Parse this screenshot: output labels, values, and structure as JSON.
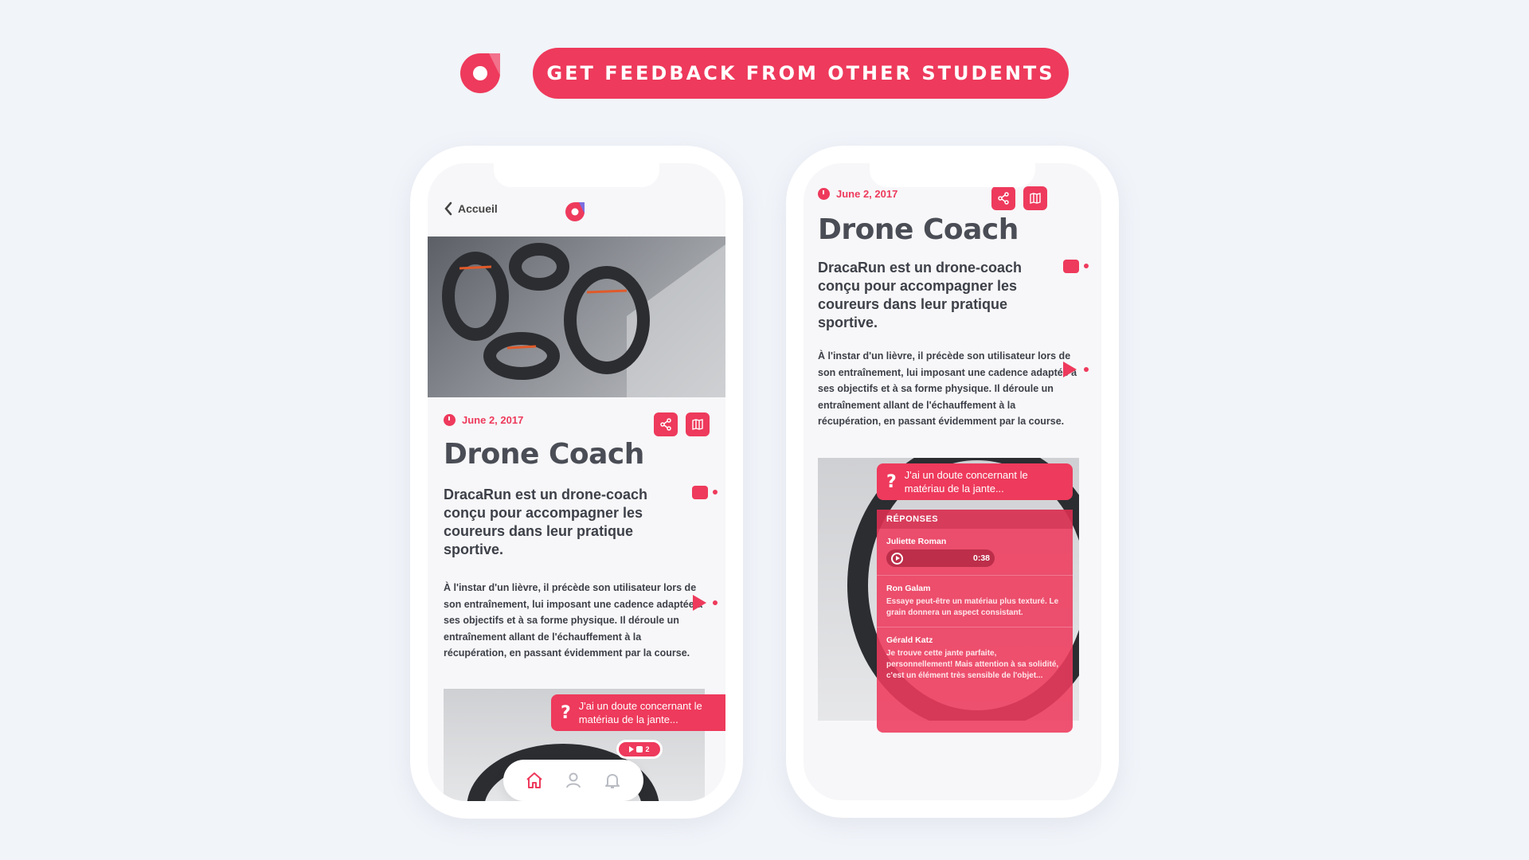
{
  "header": {
    "banner_label": "GET FEEDBACK FROM OTHER STUDENTS",
    "brand_color": "#ee3a5c"
  },
  "phone1": {
    "back_label": "Accueil",
    "date": "June 2, 2017",
    "title": "Drone Coach",
    "lead": "DracaRun est un drone-coach conçu pour accompagner les coureurs dans leur pratique sportive.",
    "body": "À l'instar d'un lièvre, il précède son utilisateur lors de son entraînement, lui imposant une cadence adaptée à ses objectifs et à sa forme physique. Il déroule un entraînement allant de l'échauffement à la récupération, en passant évidemment par la course.",
    "question": "J'ai un doute concernant le matériau de la jante...",
    "question_count": "2",
    "tabs": [
      "home-icon",
      "user-icon",
      "bell-icon"
    ]
  },
  "phone2": {
    "date": "June 2, 2017",
    "title": "Drone Coach",
    "lead": "DracaRun est un drone-coach conçu pour accompagner les coureurs dans leur pratique sportive.",
    "body": "À l'instar d'un lièvre, il précède son utilisateur lors de son entraînement, lui imposant une cadence adaptée à ses objectifs et à sa forme physique. Il déroule un entraînement allant de l'échauffement à la récupération, en passant évidemment par la course.",
    "question": "J'ai un doute concernant le matériau de la jante...",
    "answers_header": "RÉPONSES",
    "answers": [
      {
        "name": "Juliette Roman",
        "audio_duration": "0:38"
      },
      {
        "name": "Ron Galam",
        "text": "Essaye peut-être un matériau plus texturé. Le grain donnera un aspect consistant."
      },
      {
        "name": "Gérald Katz",
        "text": "Je trouve cette jante parfaite, personnellement! Mais attention à sa solidité, c'est un élément très sensible de l'objet..."
      }
    ]
  }
}
